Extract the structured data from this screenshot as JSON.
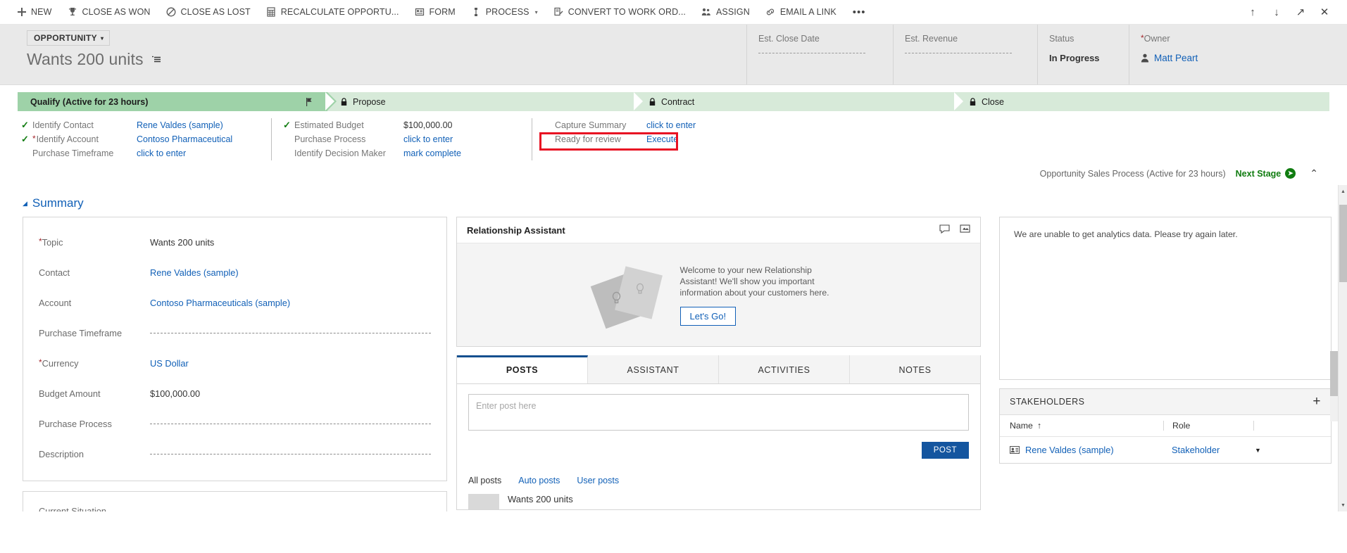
{
  "commandbar": {
    "items": [
      {
        "label": "NEW",
        "icon": "plus-icon"
      },
      {
        "label": "CLOSE AS WON",
        "icon": "trophy-icon"
      },
      {
        "label": "CLOSE AS LOST",
        "icon": "block-icon"
      },
      {
        "label": "RECALCULATE OPPORTU...",
        "icon": "calculator-icon"
      },
      {
        "label": "FORM",
        "icon": "form-icon"
      },
      {
        "label": "PROCESS",
        "icon": "process-icon",
        "caret": "▾"
      },
      {
        "label": "CONVERT TO WORK ORD...",
        "icon": "convert-icon"
      },
      {
        "label": "ASSIGN",
        "icon": "assign-icon"
      },
      {
        "label": "EMAIL A LINK",
        "icon": "link-icon"
      }
    ],
    "overflow": "•••",
    "right_buttons": [
      {
        "name": "previous-record-button",
        "glyph": "↑"
      },
      {
        "name": "next-record-button",
        "glyph": "↓"
      },
      {
        "name": "popout-button",
        "glyph": "↗"
      },
      {
        "name": "close-button",
        "glyph": "✕"
      }
    ]
  },
  "header": {
    "entity_type": "OPPORTUNITY",
    "entity_caret": "▾",
    "record_title": "Wants 200 units",
    "fields": [
      {
        "label": "Est. Close Date",
        "value": "",
        "required": false,
        "empty": true
      },
      {
        "label": "Est. Revenue",
        "value": "",
        "required": false,
        "empty": true
      },
      {
        "label": "Status",
        "value": "In Progress",
        "required": false,
        "empty": false
      },
      {
        "label": "Owner",
        "value": "Matt Peart",
        "required": true,
        "empty": false,
        "is_link": true
      }
    ]
  },
  "process": {
    "stages": [
      {
        "name": "Qualify (Active for 23 hours)",
        "state": "active",
        "locked": false
      },
      {
        "name": "Propose",
        "state": "inactive",
        "locked": true
      },
      {
        "name": "Contract",
        "state": "inactive",
        "locked": true
      },
      {
        "name": "Close",
        "state": "inactive",
        "locked": true
      }
    ],
    "columns": [
      {
        "rows": [
          {
            "checked": true,
            "required": false,
            "label": "Identify Contact",
            "value": "Rene Valdes (sample)",
            "is_link": true
          },
          {
            "checked": true,
            "required": true,
            "label": "Identify Account",
            "value": "Contoso Pharmaceutical",
            "is_link": true
          },
          {
            "checked": false,
            "required": false,
            "label": "Purchase Timeframe",
            "value": "click to enter",
            "is_link": true
          }
        ]
      },
      {
        "rows": [
          {
            "checked": true,
            "required": false,
            "label": "Estimated Budget",
            "value": "$100,000.00",
            "is_link": false
          },
          {
            "checked": false,
            "required": false,
            "label": "Purchase Process",
            "value": "click to enter",
            "is_link": true
          },
          {
            "checked": false,
            "required": false,
            "label": "Identify Decision Maker",
            "value": "mark complete",
            "is_link": true
          }
        ]
      },
      {
        "highlighted": true,
        "rows": [
          {
            "checked": false,
            "required": false,
            "label": "Capture Summary",
            "value": "click to enter",
            "is_link": true
          },
          {
            "checked": false,
            "required": false,
            "label": "Ready for review",
            "value": "Execute",
            "is_link": true
          }
        ]
      }
    ],
    "footer_process_name": "Opportunity Sales Process (Active for 23 hours)",
    "next_stage_label": "Next Stage",
    "collapse_glyph": "⌃"
  },
  "summary": {
    "heading": "Summary",
    "heading_tri": "◢",
    "fields": [
      {
        "label": "Topic",
        "value": "Wants 200 units",
        "required": true,
        "is_link": false,
        "empty": false
      },
      {
        "label": "Contact",
        "value": "Rene Valdes (sample)",
        "required": false,
        "is_link": true,
        "empty": false
      },
      {
        "label": "Account",
        "value": "Contoso Pharmaceuticals (sample)",
        "required": false,
        "is_link": true,
        "empty": false
      },
      {
        "label": "Purchase Timeframe",
        "value": "",
        "required": false,
        "is_link": false,
        "empty": true
      },
      {
        "label": "Currency",
        "value": "US Dollar",
        "required": true,
        "is_link": true,
        "empty": false
      },
      {
        "label": "Budget Amount",
        "value": "$100,000.00",
        "required": false,
        "is_link": false,
        "empty": false
      },
      {
        "label": "Purchase Process",
        "value": "",
        "required": false,
        "is_link": false,
        "empty": true
      },
      {
        "label": "Description",
        "value": "",
        "required": false,
        "is_link": false,
        "empty": true
      }
    ],
    "current_situation_label": "Current Situation"
  },
  "relationship_assistant": {
    "title": "Relationship Assistant",
    "welcome_text": "Welcome to your new Relationship Assistant! We'll show you important information about your customers here.",
    "cta_label": "Let's Go!"
  },
  "social_pane": {
    "tabs": [
      {
        "label": "POSTS",
        "active": true
      },
      {
        "label": "ASSISTANT",
        "active": false
      },
      {
        "label": "ACTIVITIES",
        "active": false
      },
      {
        "label": "NOTES",
        "active": false
      }
    ],
    "post_placeholder": "Enter post here",
    "post_button": "POST",
    "filters": [
      {
        "label": "All posts",
        "active": true
      },
      {
        "label": "Auto posts",
        "active": false
      },
      {
        "label": "User posts",
        "active": false
      }
    ],
    "first_post_title": "Wants 200 units"
  },
  "analytics": {
    "message": "We are unable to get analytics data. Please try again later."
  },
  "stakeholders": {
    "title": "STAKEHOLDERS",
    "add_glyph": "+",
    "columns": [
      {
        "label": "Name",
        "sort": "↑"
      },
      {
        "label": "Role"
      }
    ],
    "rows": [
      {
        "name": "Rene Valdes (sample)",
        "role": "Stakeholder"
      }
    ]
  },
  "colors": {
    "accent_blue": "#1160b7",
    "stage_active_green": "#9ed2a8",
    "stage_inactive_green": "#d7ead9",
    "check_green": "#107c10",
    "highlight_red": "#e81123",
    "post_button_blue": "#14559f",
    "required_star_red": "#a4262c"
  }
}
